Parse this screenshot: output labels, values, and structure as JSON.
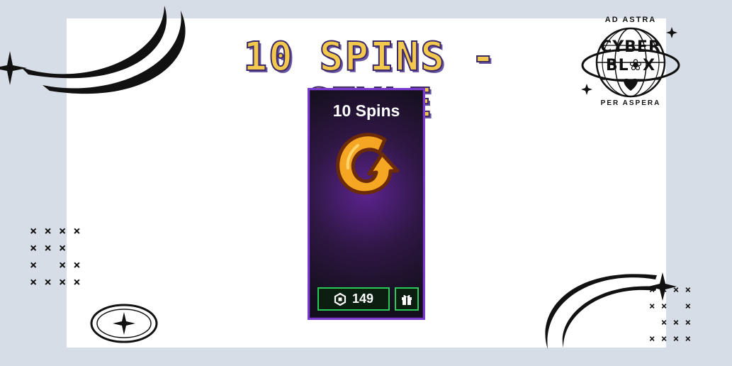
{
  "title": "10 SPINS - STYLE",
  "card": {
    "title": "10 Spins",
    "icon": "spin-arrow-icon",
    "price": "149",
    "currency_icon": "robux-icon",
    "gift_icon": "gift-icon"
  },
  "logo": {
    "top_text": "AD ASTRA",
    "line1": "CYBER",
    "line2": "BL❀X",
    "bottom_text": "PER ASPERA"
  },
  "decorations": {
    "x_grid_left": "× × × ×\n× × ×\n×   × ×\n× × × ×",
    "x_grid_right": "× × × ×\n× ×   ×\n  × × ×\n× × × ×"
  },
  "colors": {
    "background": "#d7dde6",
    "panel": "#ffffff",
    "title_fill": "#f2c94c",
    "title_outline": "#3b2a66",
    "card_border": "#7b3bd0",
    "button_border": "#2bc85a",
    "icon_orange": "#f5a623"
  }
}
